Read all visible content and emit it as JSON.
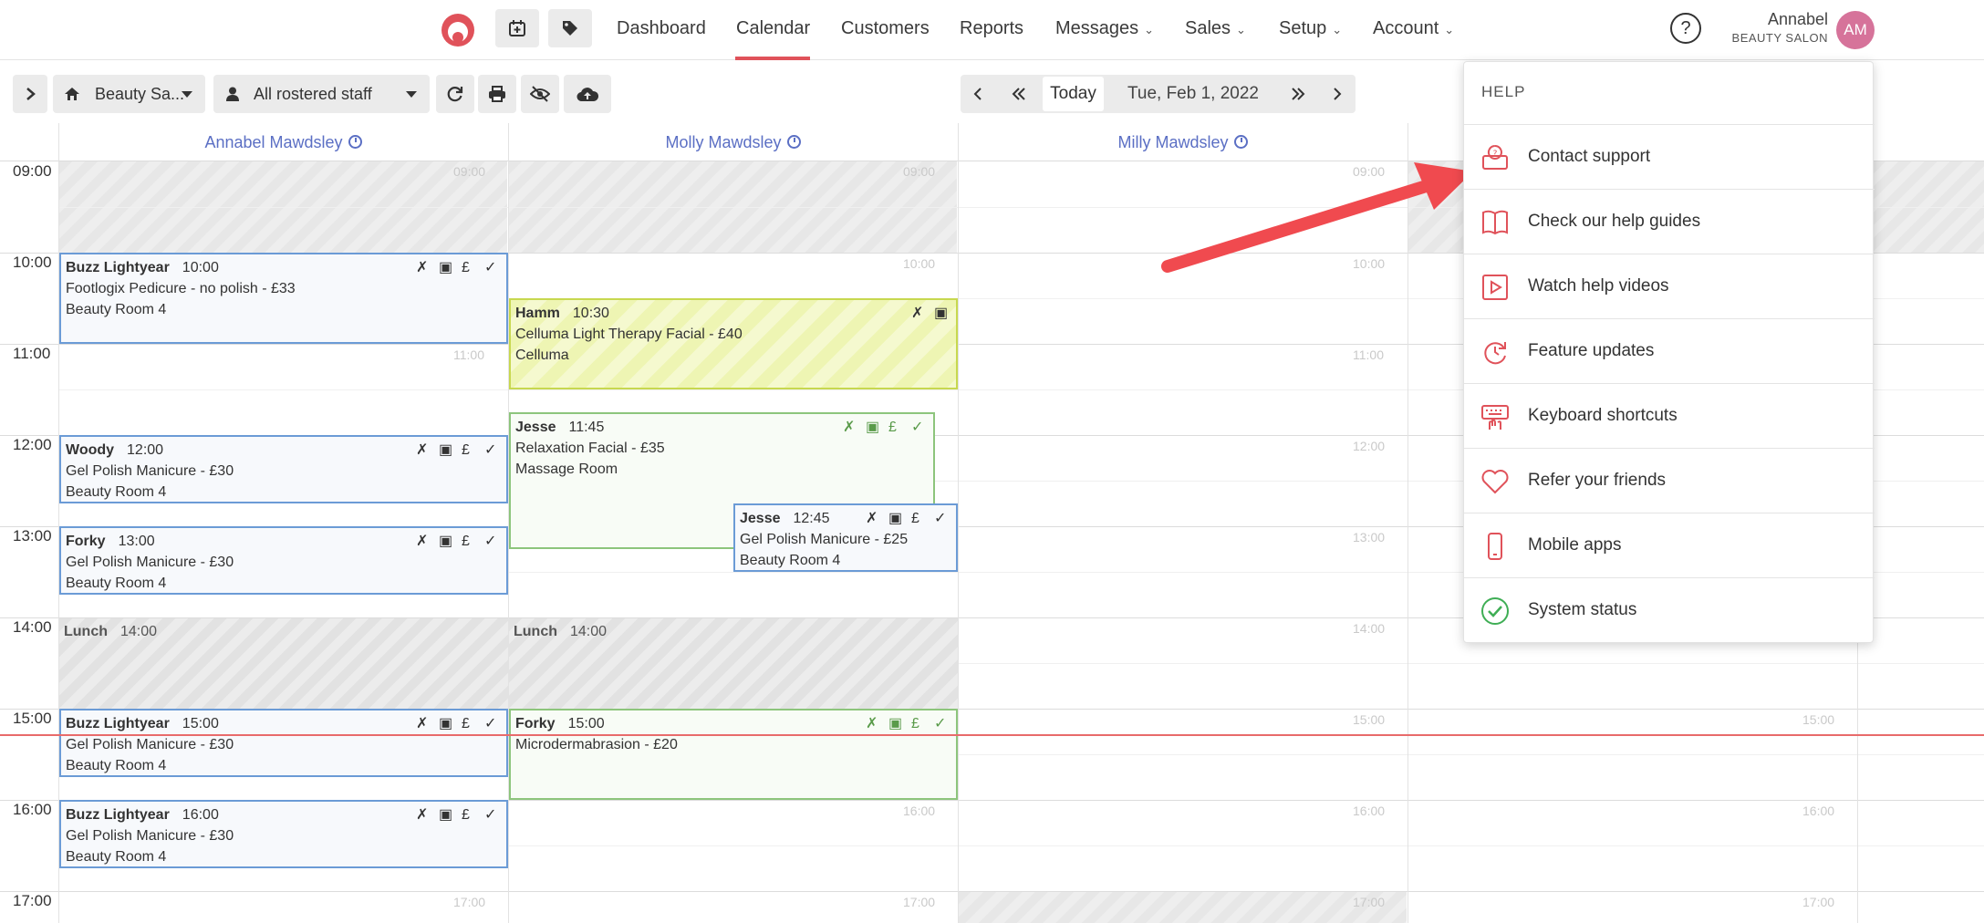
{
  "nav": {
    "links": [
      "Dashboard",
      "Calendar",
      "Customers",
      "Reports",
      "Messages",
      "Sales",
      "Setup",
      "Account"
    ],
    "active": "Calendar",
    "user_name": "Annabel",
    "user_sub": "BEAUTY SALON",
    "avatar_initials": "AM",
    "accent_color": "#e0525a"
  },
  "toolbar": {
    "location": "Beauty Sa...",
    "staff_filter": "All rostered staff",
    "today_label": "Today",
    "date_label": "Tue, Feb 1, 2022"
  },
  "staff": [
    "Annabel Mawdsley",
    "Molly Mawdsley",
    "Milly Mawdsley"
  ],
  "times": [
    "09:00",
    "10:00",
    "11:00",
    "12:00",
    "13:00",
    "14:00",
    "15:00",
    "16:00",
    "17:00"
  ],
  "appointments": [
    {
      "name": "Buzz Lightyear",
      "time": "10:00",
      "service": "Footlogix Pedicure - no polish - £33",
      "room": "Beauty Room 4"
    },
    {
      "name": "Hamm",
      "time": "10:30",
      "service": "Celluma Light Therapy Facial - £40",
      "room": "Celluma"
    },
    {
      "name": "Jesse",
      "time": "11:45",
      "service": "Relaxation Facial - £35",
      "room": "Massage Room"
    },
    {
      "name": "Woody",
      "time": "12:00",
      "service": "Gel Polish Manicure - £30",
      "room": "Beauty Room 4"
    },
    {
      "name": "Jesse",
      "time": "12:45",
      "service": "Gel Polish Manicure - £25",
      "room": "Beauty Room 4"
    },
    {
      "name": "Forky",
      "time": "13:00",
      "service": "Gel Polish Manicure - £30",
      "room": "Beauty Room 4"
    },
    {
      "name": "Lunch",
      "time": "14:00"
    },
    {
      "name": "Lunch",
      "time": "14:00"
    },
    {
      "name": "Buzz Lightyear",
      "time": "15:00",
      "service": "Gel Polish Manicure - £30",
      "room": "Beauty Room 4"
    },
    {
      "name": "Forky",
      "time": "15:00",
      "service": "Microdermabrasion - £20"
    },
    {
      "name": "Buzz Lightyear",
      "time": "16:00",
      "service": "Gel Polish Manicure - £30",
      "room": "Beauty Room 4"
    }
  ],
  "help": {
    "heading": "HELP",
    "items": [
      {
        "label": "Contact support",
        "icon": "support-icon"
      },
      {
        "label": "Check our help guides",
        "icon": "book-icon"
      },
      {
        "label": "Watch help videos",
        "icon": "video-icon"
      },
      {
        "label": "Feature updates",
        "icon": "updates-icon"
      },
      {
        "label": "Keyboard shortcuts",
        "icon": "keyboard-icon"
      },
      {
        "label": "Refer your friends",
        "icon": "heart-icon"
      },
      {
        "label": "Mobile apps",
        "icon": "mobile-icon"
      },
      {
        "label": "System status",
        "icon": "check-circle-icon"
      }
    ]
  }
}
